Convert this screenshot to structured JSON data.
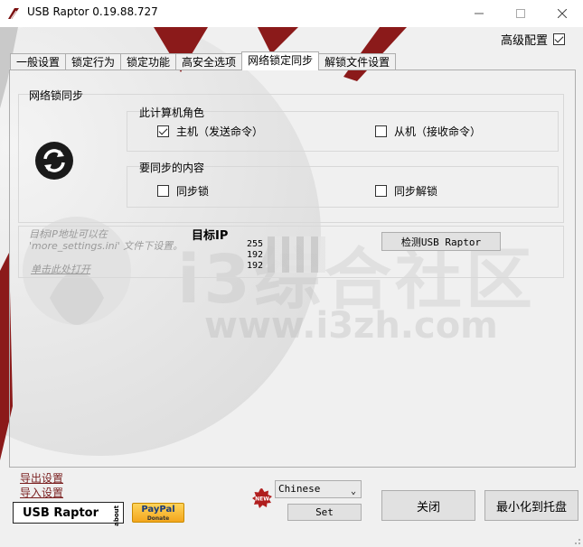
{
  "window": {
    "title": "USB Raptor 0.19.88.727",
    "minimize_icon": "minimize-icon",
    "maximize_icon": "maximize-icon",
    "close_icon": "close-icon"
  },
  "advanced_settings": {
    "label": "高级配置",
    "checked": true
  },
  "tabs": [
    {
      "label": "一般设置",
      "active": false
    },
    {
      "label": "锁定行为",
      "active": false
    },
    {
      "label": "锁定功能",
      "active": false
    },
    {
      "label": "高安全选项",
      "active": false
    },
    {
      "label": "网络锁定同步",
      "active": true
    },
    {
      "label": "解锁文件设置",
      "active": false
    }
  ],
  "network_sync": {
    "group_title": "网络锁同步",
    "role_group": {
      "title": "此计算机角色",
      "master": {
        "label": "主机（发送命令）",
        "checked": true
      },
      "slave": {
        "label": "从机（接收命令）",
        "checked": false
      }
    },
    "content_group": {
      "title": "要同步的内容",
      "sync_lock": {
        "label": "同步锁",
        "checked": false
      },
      "sync_unlock": {
        "label": "同步解锁",
        "checked": false
      }
    },
    "target_ip_hint_line1": "目标IP地址可以在",
    "target_ip_hint_line2": "'more_settings.ini' 文件下设置。",
    "click_here": "单击此处打开",
    "target_ip_label": "目标IP",
    "target_ips": [
      "255",
      "192",
      "192"
    ],
    "detect_button": "检测USB Raptor"
  },
  "watermark": {
    "line1": "i3综合社区",
    "line2": "www.i3zh.com"
  },
  "footer": {
    "export_settings": "导出设置",
    "import_settings": "导入设置",
    "logo_text": "USB Raptor",
    "logo_about": "about",
    "paypal_text": "PayPal",
    "paypal_donate": "Donate",
    "new_badge": "NEW",
    "language_value": "Chinese",
    "set_button": "Set",
    "close_button": "关闭",
    "minimize_tray_button": "最小化到托盘"
  },
  "colors": {
    "accent_red": "#8b1a1a",
    "window_bg": "#f0f0f0",
    "link": "#7a1f1f"
  }
}
